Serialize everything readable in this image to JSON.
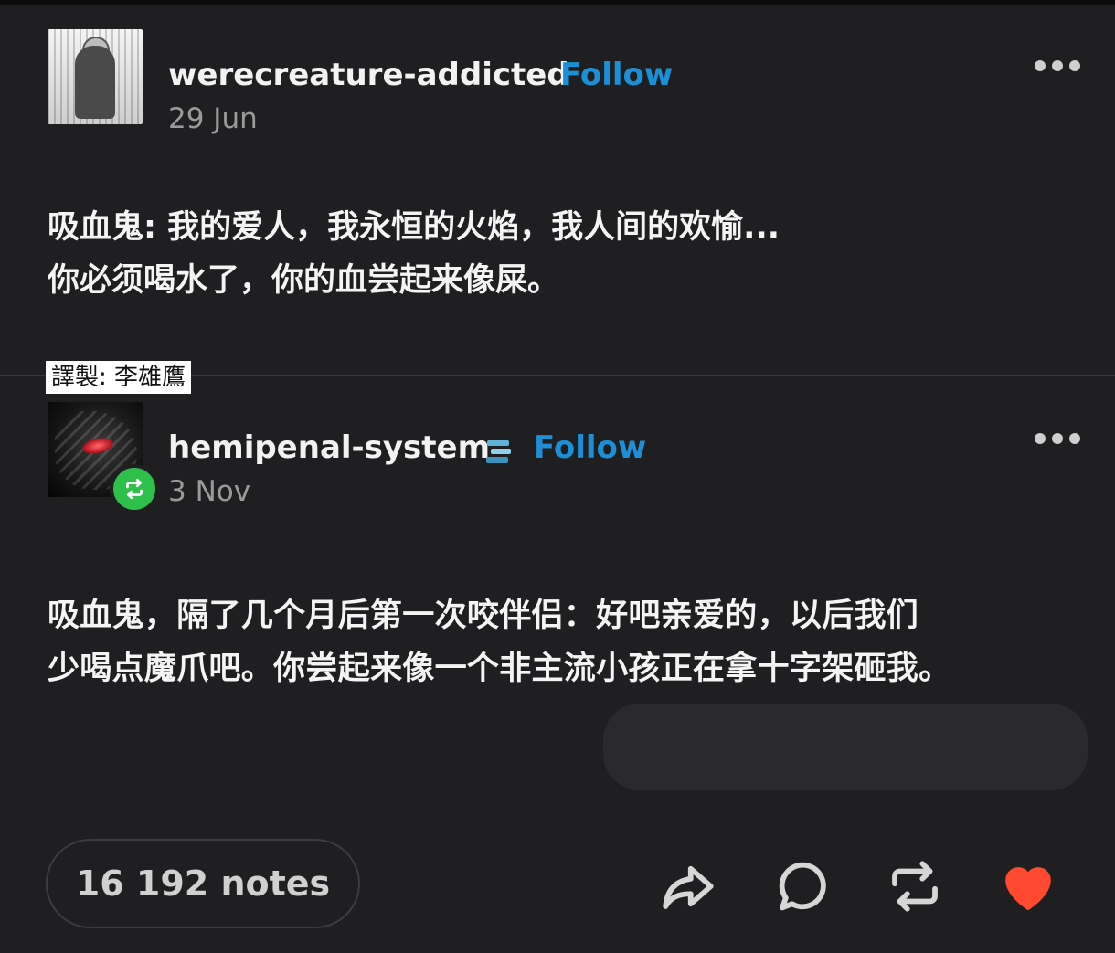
{
  "posts": [
    {
      "username": "werecreature-addicted",
      "follow_label": "Follow",
      "date": "29 Jun",
      "avatar_icon": "manga-portrait-avatar",
      "text_lines": [
        "吸血鬼: 我的爱人，我永恒的火焰，我人间的欢愉...",
        "你必须喝水了，你的血尝起来像屎。"
      ]
    },
    {
      "username": "hemipenal-system",
      "follow_label": "Follow",
      "date": "3 Nov",
      "avatar_icon": "dragon-eye-avatar",
      "badge_icon": "stacked-books-icon",
      "reblog_icon": "reblog-icon",
      "text_lines": [
        "吸血鬼，隔了几个月后第一次咬伴侣：好吧亲爱的，以后我们",
        "少喝点魔爪吧。你尝起来像一个非主流小孩正在拿十字架砸我。"
      ]
    }
  ],
  "translator_credit": "譯製: 李雄鷹",
  "footer": {
    "notes": "16 192 notes",
    "actions": [
      "share-icon",
      "reply-icon",
      "reblog-icon",
      "like-heart-icon"
    ],
    "like_color": "#ff4930"
  },
  "colors": {
    "background": "#1f1f21",
    "follow": "#1c8fd6",
    "reblog_badge": "#2fbf4b"
  }
}
